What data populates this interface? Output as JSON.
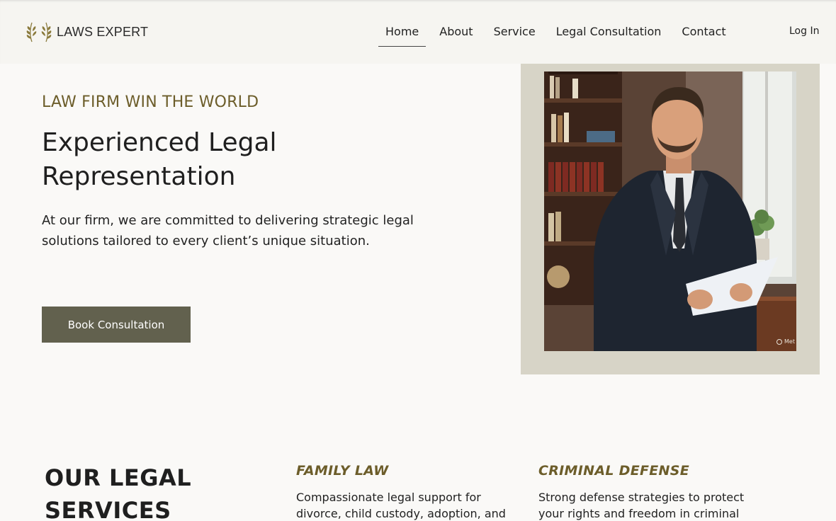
{
  "header": {
    "logo_text": "LAWS EXPERT",
    "logo_icon": "laurel-icon",
    "nav": [
      {
        "label": "Home",
        "active": true
      },
      {
        "label": "About",
        "active": false
      },
      {
        "label": "Service",
        "active": false
      },
      {
        "label": "Legal Consultation",
        "active": false
      },
      {
        "label": "Contact",
        "active": false
      }
    ],
    "login_label": "Log In"
  },
  "hero": {
    "eyebrow": "LAW FIRM WIN THE WORLD",
    "title_line1": "Experienced Legal",
    "title_line2": "Representation",
    "description": "At our firm, we are committed to delivering strategic legal solutions tailored to every client’s unique situation.",
    "cta_label": "Book Consultation",
    "photo_badge": "Met"
  },
  "services": {
    "title_line1": "OUR LEGAL",
    "title_line2": "SERVICES",
    "items": [
      {
        "title": "FAMILY LAW",
        "description": "Compassionate legal support for divorce, child custody, adoption, and"
      },
      {
        "title": "CRIMINAL DEFENSE",
        "description": "Strong defense strategies to protect your rights and freedom in criminal"
      }
    ]
  },
  "colors": {
    "accent_gold": "#6c5d2a",
    "button_bg": "#62614e",
    "frame_bg": "#d7d4c7",
    "page_bg": "#faf9f7"
  }
}
